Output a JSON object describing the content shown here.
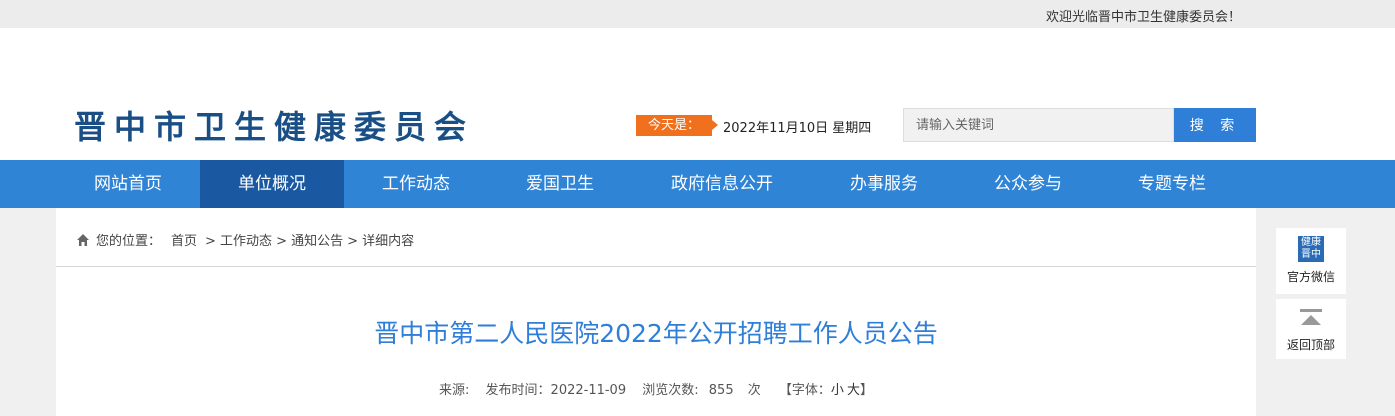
{
  "topbar": {
    "welcome": "欢迎光临晋中市卫生健康委员会！"
  },
  "header": {
    "logo": "晋中市卫生健康委员会",
    "today_label": "今天是：",
    "date": "2022年11月10日 星期四",
    "search_placeholder": "请输入关键词",
    "search_button": "搜 索"
  },
  "nav": {
    "items": [
      {
        "label": "网站首页"
      },
      {
        "label": "单位概况"
      },
      {
        "label": "工作动态"
      },
      {
        "label": "爱国卫生"
      },
      {
        "label": "政府信息公开"
      },
      {
        "label": "办事服务"
      },
      {
        "label": "公众参与"
      },
      {
        "label": "专题专栏"
      }
    ],
    "active_index": 1
  },
  "breadcrumb": {
    "prefix": "您的位置：",
    "items": [
      "首页",
      "> 工作动态",
      "> 通知公告",
      "> 详细内容"
    ]
  },
  "article": {
    "title": "晋中市第二人民医院2022年公开招聘工作人员公告",
    "source_label": "来源:",
    "publish_label": "发布时间：2022-11-09",
    "views_label": "浏览次数:",
    "views": "855",
    "views_unit": "次",
    "font_prefix": "【字体：",
    "font_small": "小",
    "font_large": "大",
    "font_suffix": "】"
  },
  "side": {
    "wechat_label": "官方微信",
    "wechat_qr_text": [
      "健康",
      "晋中"
    ],
    "backtop_label": "返回顶部"
  },
  "colors": {
    "nav_bg": "#3084d6",
    "nav_active": "#1a59a2",
    "accent_orange": "#f0701e",
    "title_blue": "#2f7ed7",
    "logo_blue": "#1a4f86"
  }
}
